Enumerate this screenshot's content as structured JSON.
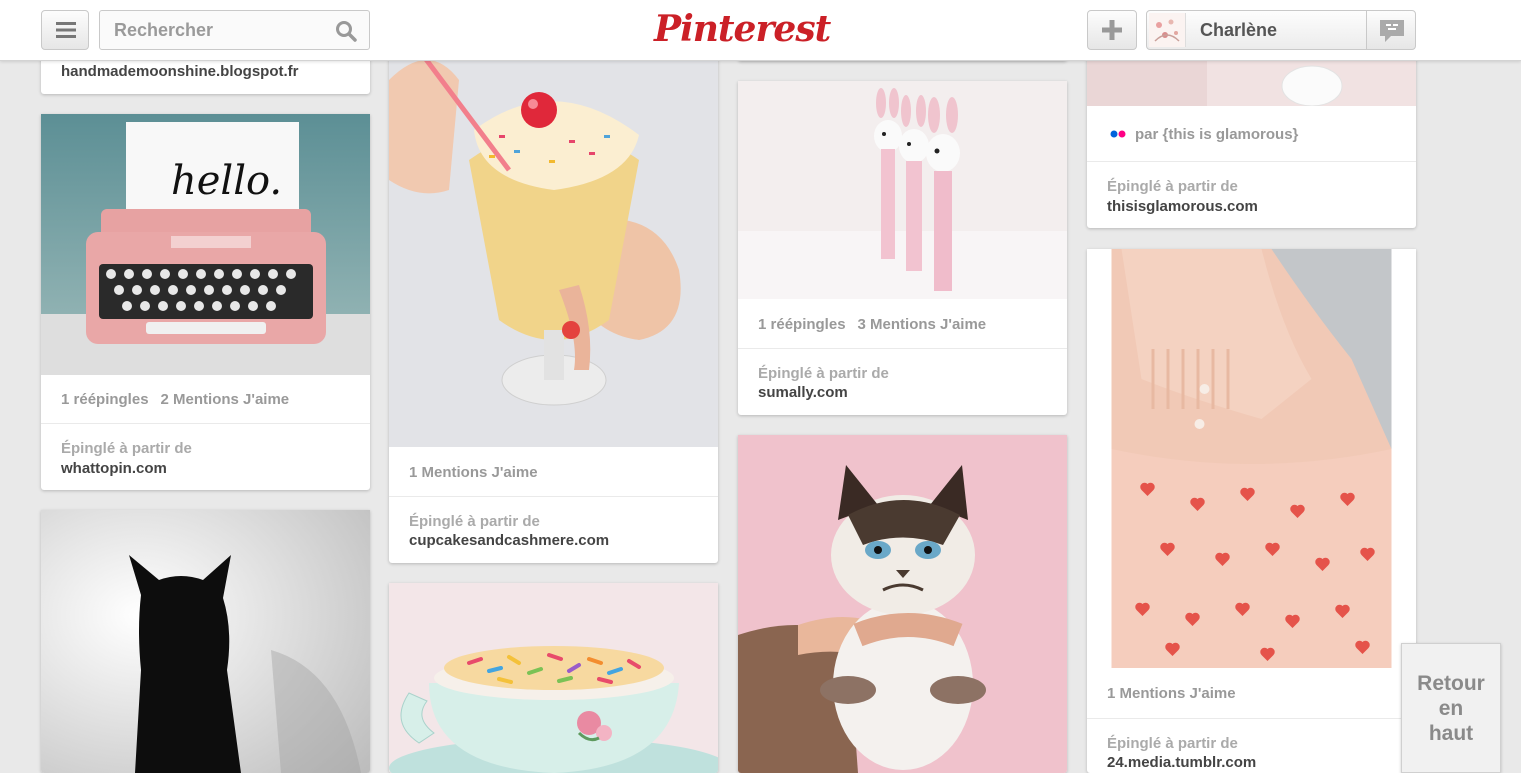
{
  "header": {
    "logo": "Pinterest",
    "search_placeholder": "Rechercher",
    "user_name": "Charlène"
  },
  "pins": {
    "col1_top": {
      "source": "handmademoonshine.blogspot.fr"
    },
    "typewriter": {
      "repins": "1 réépingles",
      "likes": "2 Mentions J'aime",
      "via_label": "Épinglé à partir de",
      "source": "whattopin.com"
    },
    "sundae": {
      "likes": "1 Mentions J'aime",
      "via_label": "Épinglé à partir de",
      "source": "cupcakesandcashmere.com"
    },
    "pez": {
      "repins": "1 réépingles",
      "likes": "3 Mentions J'aime",
      "via_label": "Épinglé à partir de",
      "source": "sumally.com"
    },
    "glamorous": {
      "par": "par {this is glamorous}",
      "via_label": "Épinglé à partir de",
      "source": "thisisglamorous.com"
    },
    "dress": {
      "likes": "1 Mentions J'aime",
      "via_label": "Épinglé à partir de",
      "source": "24.media.tumblr.com"
    }
  },
  "back_to_top": {
    "line1": "Retour",
    "line2": "en",
    "line3": "haut"
  },
  "colors": {
    "brand": "#cb2027",
    "background": "#e9e9e9"
  }
}
